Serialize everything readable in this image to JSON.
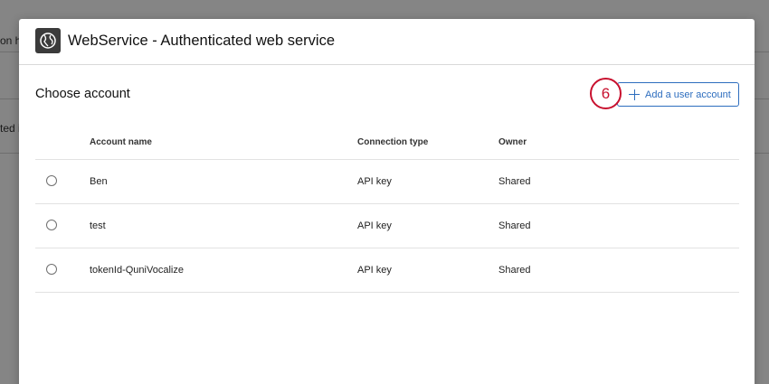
{
  "background": {
    "row1_text": "on his",
    "row2_text": "ted in"
  },
  "modal": {
    "app_icon": "globe-icon",
    "title": "WebService - Authenticated web service",
    "section_title": "Choose account",
    "add_button_label": "Add a user account",
    "step_badge": "6"
  },
  "table": {
    "headers": {
      "name": "Account name",
      "connection": "Connection type",
      "owner": "Owner"
    },
    "rows": [
      {
        "name": "Ben",
        "connection": "API key",
        "owner": "Shared"
      },
      {
        "name": "test",
        "connection": "API key",
        "owner": "Shared"
      },
      {
        "name": "tokenId-QuniVocalize",
        "connection": "API key",
        "owner": "Shared"
      }
    ]
  },
  "colors": {
    "accent": "#2d6dbe",
    "step_badge": "#c8102e"
  }
}
